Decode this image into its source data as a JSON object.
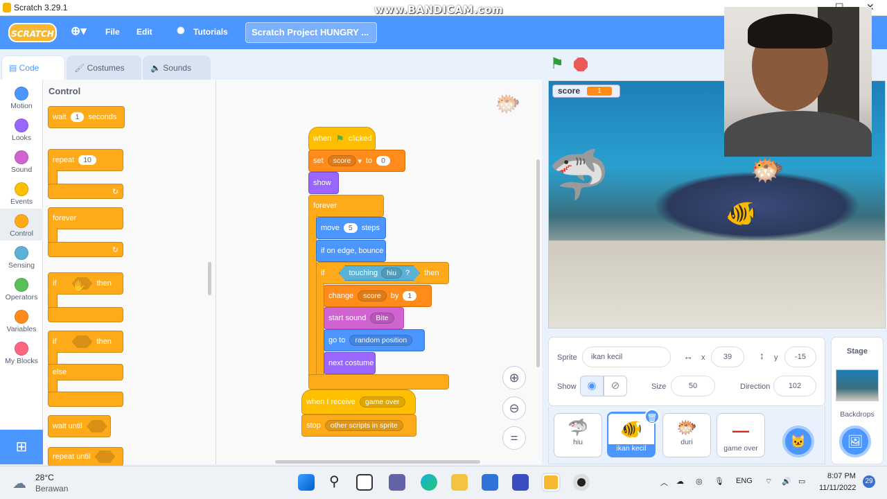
{
  "window": {
    "title": "Scratch 3.29.1",
    "watermark": "www.BANDICAM.com"
  },
  "menubar": {
    "logo": "SCRATCH",
    "file": "File",
    "edit": "Edit",
    "tutorials": "Tutorials",
    "project_title": "Scratch Project HUNGRY ..."
  },
  "tabs": [
    {
      "label": "Code"
    },
    {
      "label": "Costumes"
    },
    {
      "label": "Sounds"
    }
  ],
  "categories": [
    {
      "label": "Motion",
      "color": "#4c97ff"
    },
    {
      "label": "Looks",
      "color": "#9966ff"
    },
    {
      "label": "Sound",
      "color": "#cf63cf"
    },
    {
      "label": "Events",
      "color": "#ffbf00"
    },
    {
      "label": "Control",
      "color": "#ffab19"
    },
    {
      "label": "Sensing",
      "color": "#5cb1d6"
    },
    {
      "label": "Operators",
      "color": "#59c059"
    },
    {
      "label": "Variables",
      "color": "#ff8c1a"
    },
    {
      "label": "My Blocks",
      "color": "#ff6680"
    }
  ],
  "palette": {
    "header": "Control",
    "wait": {
      "a": "wait",
      "b": "1",
      "c": "seconds"
    },
    "repeat": {
      "a": "repeat",
      "b": "10"
    },
    "forever": "forever",
    "if_then": {
      "a": "if",
      "b": "then"
    },
    "if_else": {
      "a": "if",
      "b": "then",
      "c": "else"
    },
    "wait_until": "wait until",
    "repeat_until": "repeat until"
  },
  "script": {
    "when_flag": {
      "a": "when",
      "b": "clicked"
    },
    "set": {
      "a": "set",
      "var": "score",
      "b": "to",
      "val": "0"
    },
    "show": "show",
    "forever": "forever",
    "move": {
      "a": "move",
      "val": "5",
      "b": "steps"
    },
    "bounce": "if on edge, bounce",
    "if": {
      "a": "if",
      "b": "touching",
      "c": "hiu",
      "d": "?",
      "e": "then"
    },
    "change": {
      "a": "change",
      "var": "score",
      "b": "by",
      "val": "1"
    },
    "sound": {
      "a": "start sound",
      "val": "Bite"
    },
    "goto": {
      "a": "go to",
      "val": "random position"
    },
    "costume": "next costume",
    "receive": {
      "a": "when I receive",
      "val": "game over"
    },
    "stop": {
      "a": "stop",
      "val": "other scripts in sprite"
    }
  },
  "stage": {
    "monitor_label": "score",
    "monitor_value": "1"
  },
  "sprite_info": {
    "sprite_label": "Sprite",
    "sprite_name": "ikan kecil",
    "x_label": "x",
    "x": "39",
    "y_label": "y",
    "y": "-15",
    "show_label": "Show",
    "size_label": "Size",
    "size": "50",
    "direction_label": "Direction",
    "direction": "102"
  },
  "sprites": [
    {
      "name": "hiu"
    },
    {
      "name": "ikan kecil"
    },
    {
      "name": "duri"
    },
    {
      "name": "game over"
    }
  ],
  "stage_panel": {
    "title": "Stage",
    "backdrops": "Backdrops"
  },
  "taskbar": {
    "temp": "28°C",
    "weather": "Berawan",
    "lang": "ENG",
    "time": "8:07 PM",
    "date": "11/11/2022",
    "badge": "29"
  }
}
